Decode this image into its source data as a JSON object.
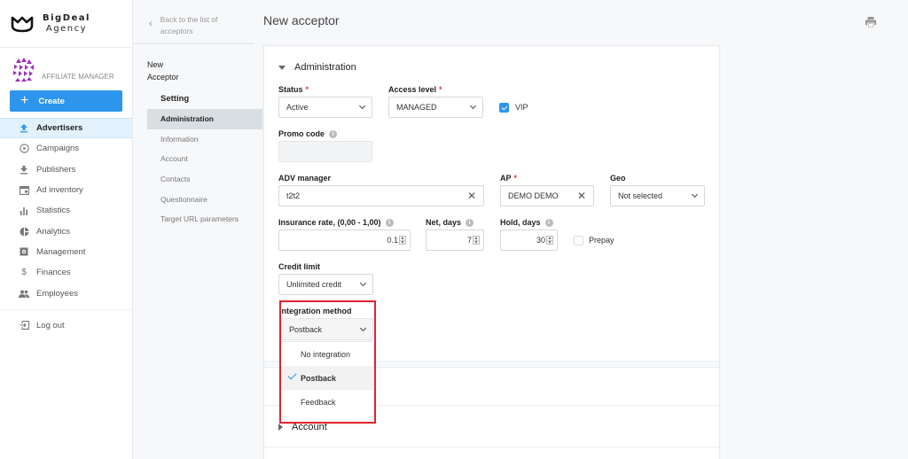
{
  "brand": {
    "name": "BigDeal",
    "sub": "Agency"
  },
  "user": {
    "role": "AFFILIATE MANAGER"
  },
  "sidebar": {
    "create_label": "Create",
    "items": [
      {
        "label": "Advertisers",
        "icon": "upload-icon",
        "active": true
      },
      {
        "label": "Campaigns",
        "icon": "play-circle-icon"
      },
      {
        "label": "Publishers",
        "icon": "download-icon"
      },
      {
        "label": "Ad inventory",
        "icon": "inventory-icon"
      },
      {
        "label": "Statistics",
        "icon": "bar-chart-icon"
      },
      {
        "label": "Analytics",
        "icon": "pie-chart-icon"
      },
      {
        "label": "Management",
        "icon": "gear-box-icon"
      },
      {
        "label": "Finances",
        "icon": "dollar-icon"
      },
      {
        "label": "Employees",
        "icon": "people-icon"
      }
    ],
    "logout_label": "Log out"
  },
  "subnav": {
    "back_label": "Back to the list of acceptors",
    "entity_name_line1": "New",
    "entity_name_line2": "Acceptor",
    "heading": "Setting",
    "items": [
      {
        "label": "Administration",
        "active": true
      },
      {
        "label": "Information"
      },
      {
        "label": "Account"
      },
      {
        "label": "Contacts"
      },
      {
        "label": "Questionnaire"
      },
      {
        "label": "Target URL parameters"
      }
    ]
  },
  "page": {
    "title": "New acceptor"
  },
  "form": {
    "section_title": "Administration",
    "status": {
      "label": "Status",
      "value": "Active",
      "required": "*"
    },
    "access_level": {
      "label": "Access level",
      "value": "MANAGED",
      "required": "*"
    },
    "vip": {
      "label": "VIP",
      "checked": true
    },
    "promo_code": {
      "label": "Promo code",
      "value": ""
    },
    "adv_manager": {
      "label": "ADV manager",
      "value": "t2t2"
    },
    "ap": {
      "label": "AP",
      "value": "DEMO DEMO",
      "required": "*"
    },
    "geo": {
      "label": "Geo",
      "value": "Not selected"
    },
    "insurance_rate": {
      "label": "Insurance rate, (0,00 - 1,00)",
      "value": "0.1"
    },
    "net_days": {
      "label": "Net, days",
      "value": "7"
    },
    "hold_days": {
      "label": "Hold, days",
      "value": "30"
    },
    "prepay": {
      "label": "Prepay",
      "checked": false
    },
    "credit_limit": {
      "label": "Credit limit",
      "value": "Unlimited credit"
    },
    "integration_method": {
      "label": "Integration method",
      "value": "Postback",
      "options": [
        "No integration",
        "Postback",
        "Feedback"
      ]
    },
    "account_section_title": "Account"
  },
  "colors": {
    "accent": "#2d95ec",
    "highlight": "#e2232f",
    "required": "#ee3333"
  }
}
